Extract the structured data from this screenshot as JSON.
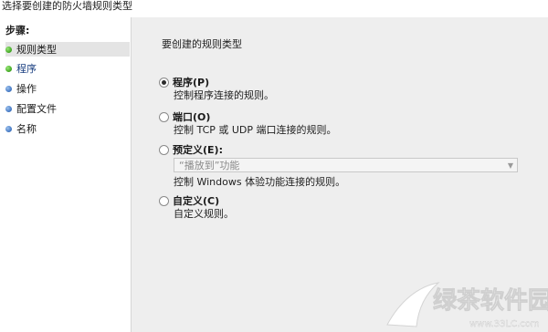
{
  "header": {
    "subtitle": "选择要创建的防火墙规则类型"
  },
  "sidebar": {
    "heading": "步骤:",
    "items": [
      {
        "label": "规则类型",
        "dot": "green",
        "active": true
      },
      {
        "label": "程序",
        "dot": "green",
        "current": true
      },
      {
        "label": "操作",
        "dot": "blue"
      },
      {
        "label": "配置文件",
        "dot": "blue"
      },
      {
        "label": "名称",
        "dot": "blue"
      }
    ]
  },
  "main": {
    "section_title": "要创建的规则类型",
    "options": [
      {
        "label": "程序(P)",
        "desc": "控制程序连接的规则。",
        "checked": true
      },
      {
        "label": "端口(O)",
        "desc": "控制 TCP 或 UDP 端口连接的规则。",
        "checked": false
      },
      {
        "label": "预定义(E):",
        "desc": "控制 Windows 体验功能连接的规则。",
        "checked": false
      },
      {
        "label": "自定义(C)",
        "desc": "自定义规则。",
        "checked": false
      }
    ],
    "predefined_select": {
      "value": "“播放到”功能",
      "disabled": true
    }
  },
  "watermark": {
    "brand": "绿茶软件园",
    "url": "www.33LC.com"
  },
  "colors": {
    "step_done": "#3da41f",
    "step_todo": "#3f74c0",
    "panel_bg": "#eeeeee"
  }
}
